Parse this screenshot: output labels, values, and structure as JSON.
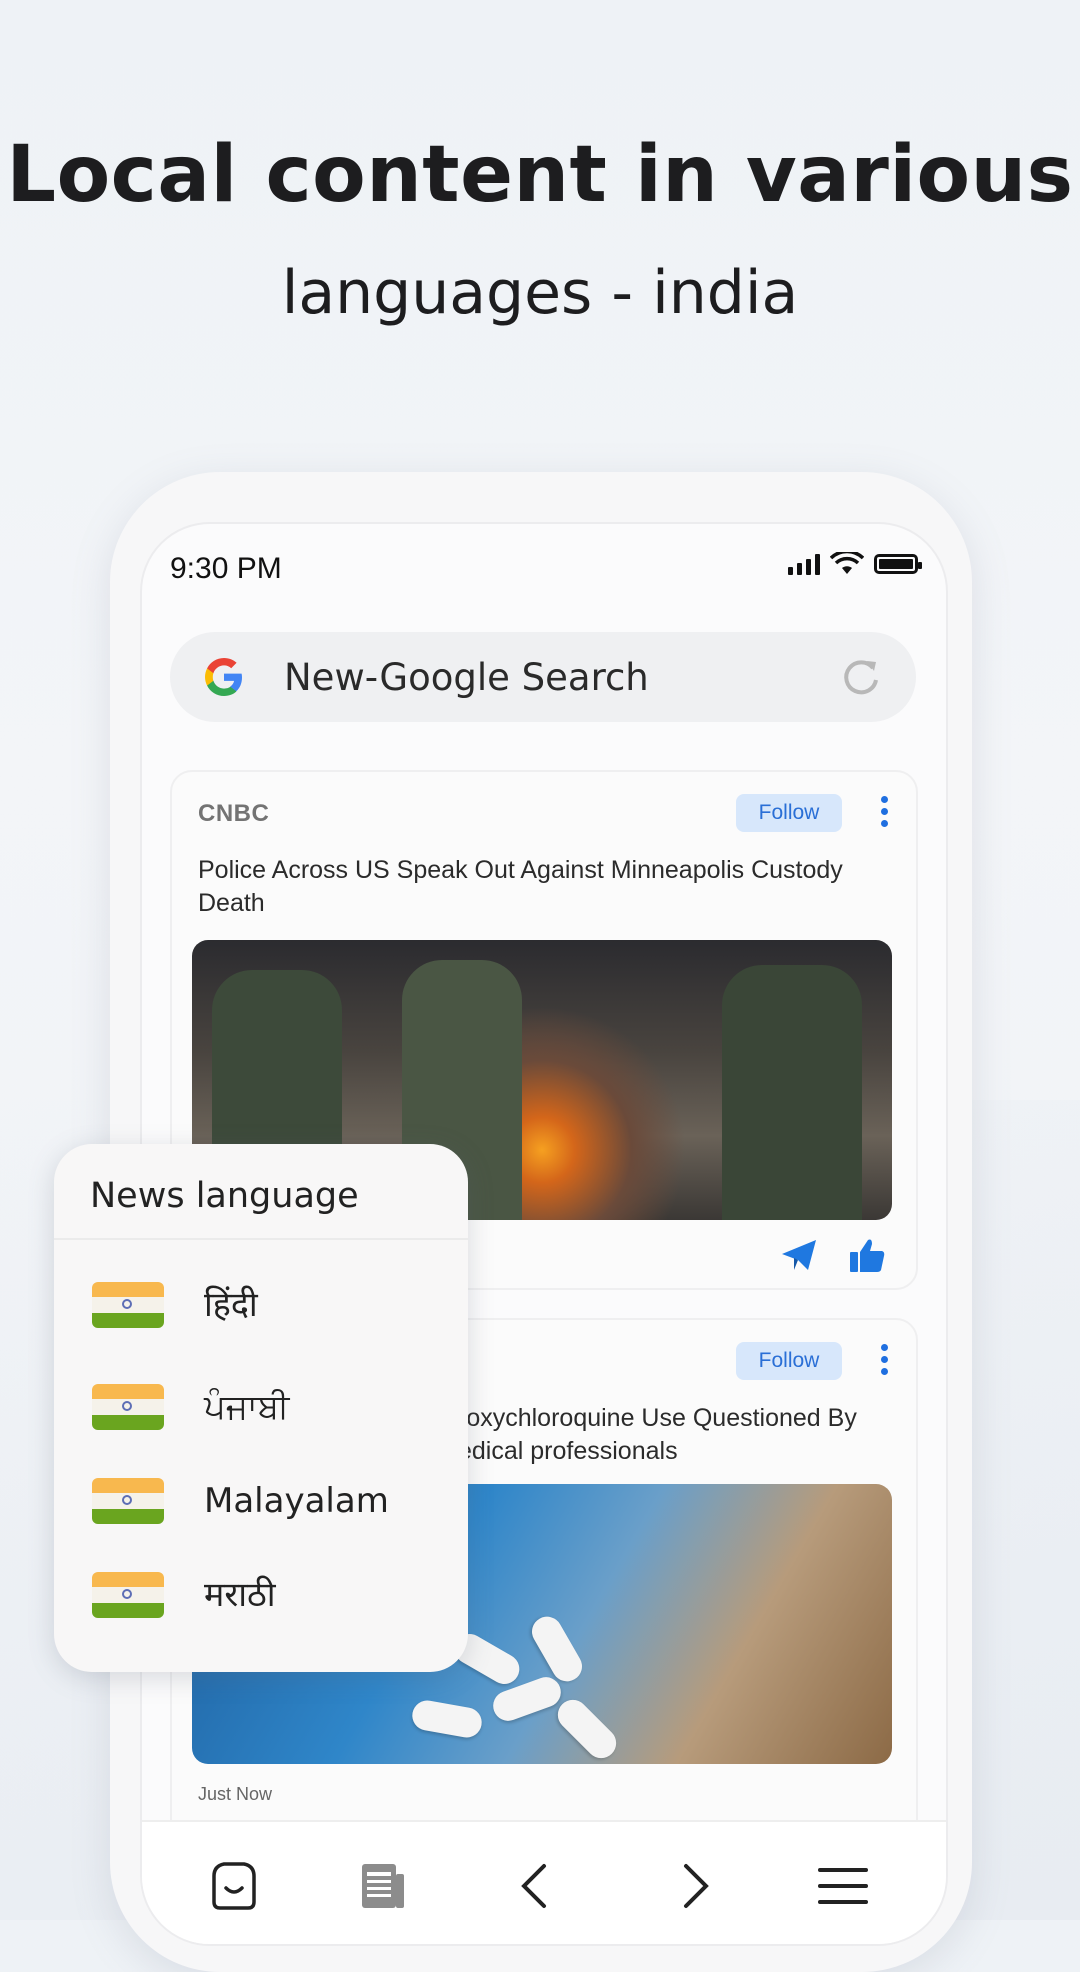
{
  "headline": "Local content in various",
  "subheadline": "languages - india",
  "status_bar": {
    "time": "9:30 PM"
  },
  "search": {
    "label": "New-Google Search"
  },
  "feed": [
    {
      "source": "CNBC",
      "follow_label": "Follow",
      "title": "Police Across US Speak Out Against Minneapolis Custody Death"
    },
    {
      "follow_label": "Follow",
      "title_line1": "roxychloroquine Use Questioned By",
      "title_line2": "edical professionals",
      "meta": "Just Now"
    }
  ],
  "language_panel": {
    "title": "News language",
    "languages": [
      {
        "label": "हिंदी"
      },
      {
        "label": "ਪੰਜਾਬੀ"
      },
      {
        "label": "Malayalam"
      },
      {
        "label": "मराठी"
      }
    ]
  },
  "colors": {
    "accent": "#1f6fe0",
    "follow_bg": "#d7e7fb"
  },
  "icons": [
    "google-icon",
    "reload-icon",
    "more-icon",
    "send-icon",
    "like-icon",
    "home-icon",
    "news-icon",
    "back-icon",
    "forward-icon",
    "menu-icon",
    "india-flag-icon"
  ]
}
